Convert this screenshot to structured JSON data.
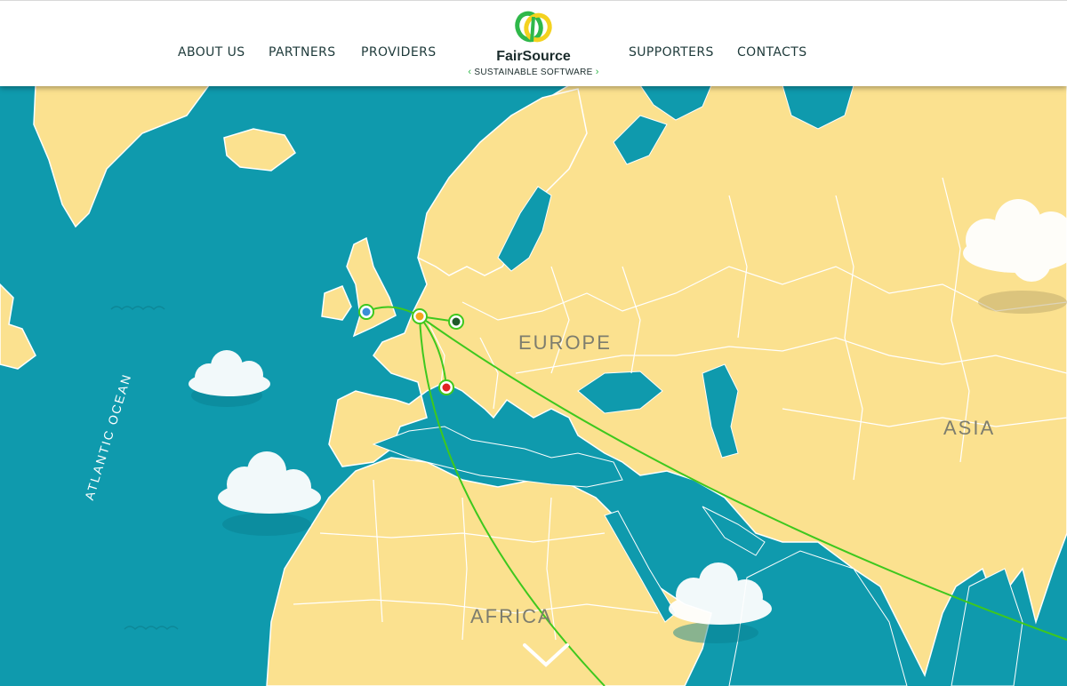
{
  "header": {
    "nav_left": [
      {
        "label": "ABOUT US"
      },
      {
        "label": "PARTNERS"
      },
      {
        "label": "PROVIDERS"
      }
    ],
    "nav_right": [
      {
        "label": "SUPPORTERS"
      },
      {
        "label": "CONTACTS"
      }
    ],
    "logo": {
      "name": "FairSource",
      "tagline": "SUSTAINABLE SOFTWARE",
      "colors": {
        "green": "#2fb84a",
        "yellow": "#f4d21f"
      }
    }
  },
  "map": {
    "labels": {
      "europe": "EUROPE",
      "asia": "ASIA",
      "africa": "AFRICA",
      "ocean": "ATLANTIC OCEAN"
    },
    "markers": [
      {
        "name": "uk",
        "color": "#3a8fd8"
      },
      {
        "name": "netherlands",
        "color": "#f4a51f"
      },
      {
        "name": "germany",
        "color": "#1f5a2a"
      },
      {
        "name": "italy",
        "color": "#e02222"
      }
    ],
    "colors": {
      "sea": "#0f9aad",
      "land": "#fbe18f",
      "border": "#ffffff",
      "route": "#3ec81e"
    }
  },
  "scroll_icon": "chevron-down-icon"
}
